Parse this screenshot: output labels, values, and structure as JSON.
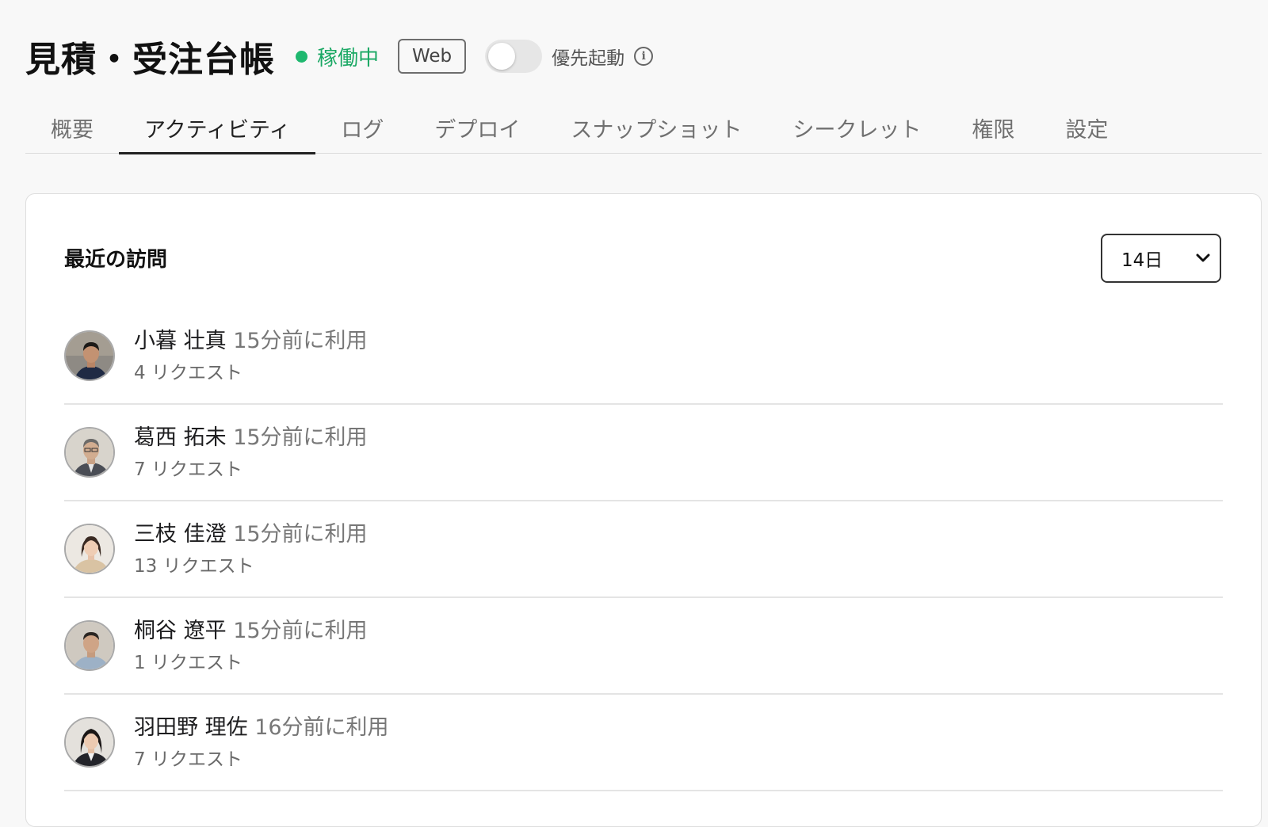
{
  "header": {
    "title": "見積・受注台帳",
    "status": "稼働中",
    "badge": "Web",
    "toggle_label": "優先起動",
    "colors": {
      "status": "#1aa864"
    }
  },
  "tabs": [
    {
      "label": "概要",
      "active": false
    },
    {
      "label": "アクティビティ",
      "active": true
    },
    {
      "label": "ログ",
      "active": false
    },
    {
      "label": "デプロイ",
      "active": false
    },
    {
      "label": "スナップショット",
      "active": false
    },
    {
      "label": "シークレット",
      "active": false
    },
    {
      "label": "権限",
      "active": false
    },
    {
      "label": "設定",
      "active": false
    }
  ],
  "visits": {
    "title": "最近の訪問",
    "range": "14日",
    "items": [
      {
        "name": "小暮 壮真",
        "used": "15分前に利用",
        "requests": "4 リクエスト"
      },
      {
        "name": "葛西 拓未",
        "used": "15分前に利用",
        "requests": "7 リクエスト"
      },
      {
        "name": "三枝 佳澄",
        "used": "15分前に利用",
        "requests": "13 リクエスト"
      },
      {
        "name": "桐谷 遼平",
        "used": "15分前に利用",
        "requests": "1 リクエスト"
      },
      {
        "name": "羽田野 理佐",
        "used": "16分前に利用",
        "requests": "7 リクエスト"
      }
    ]
  }
}
